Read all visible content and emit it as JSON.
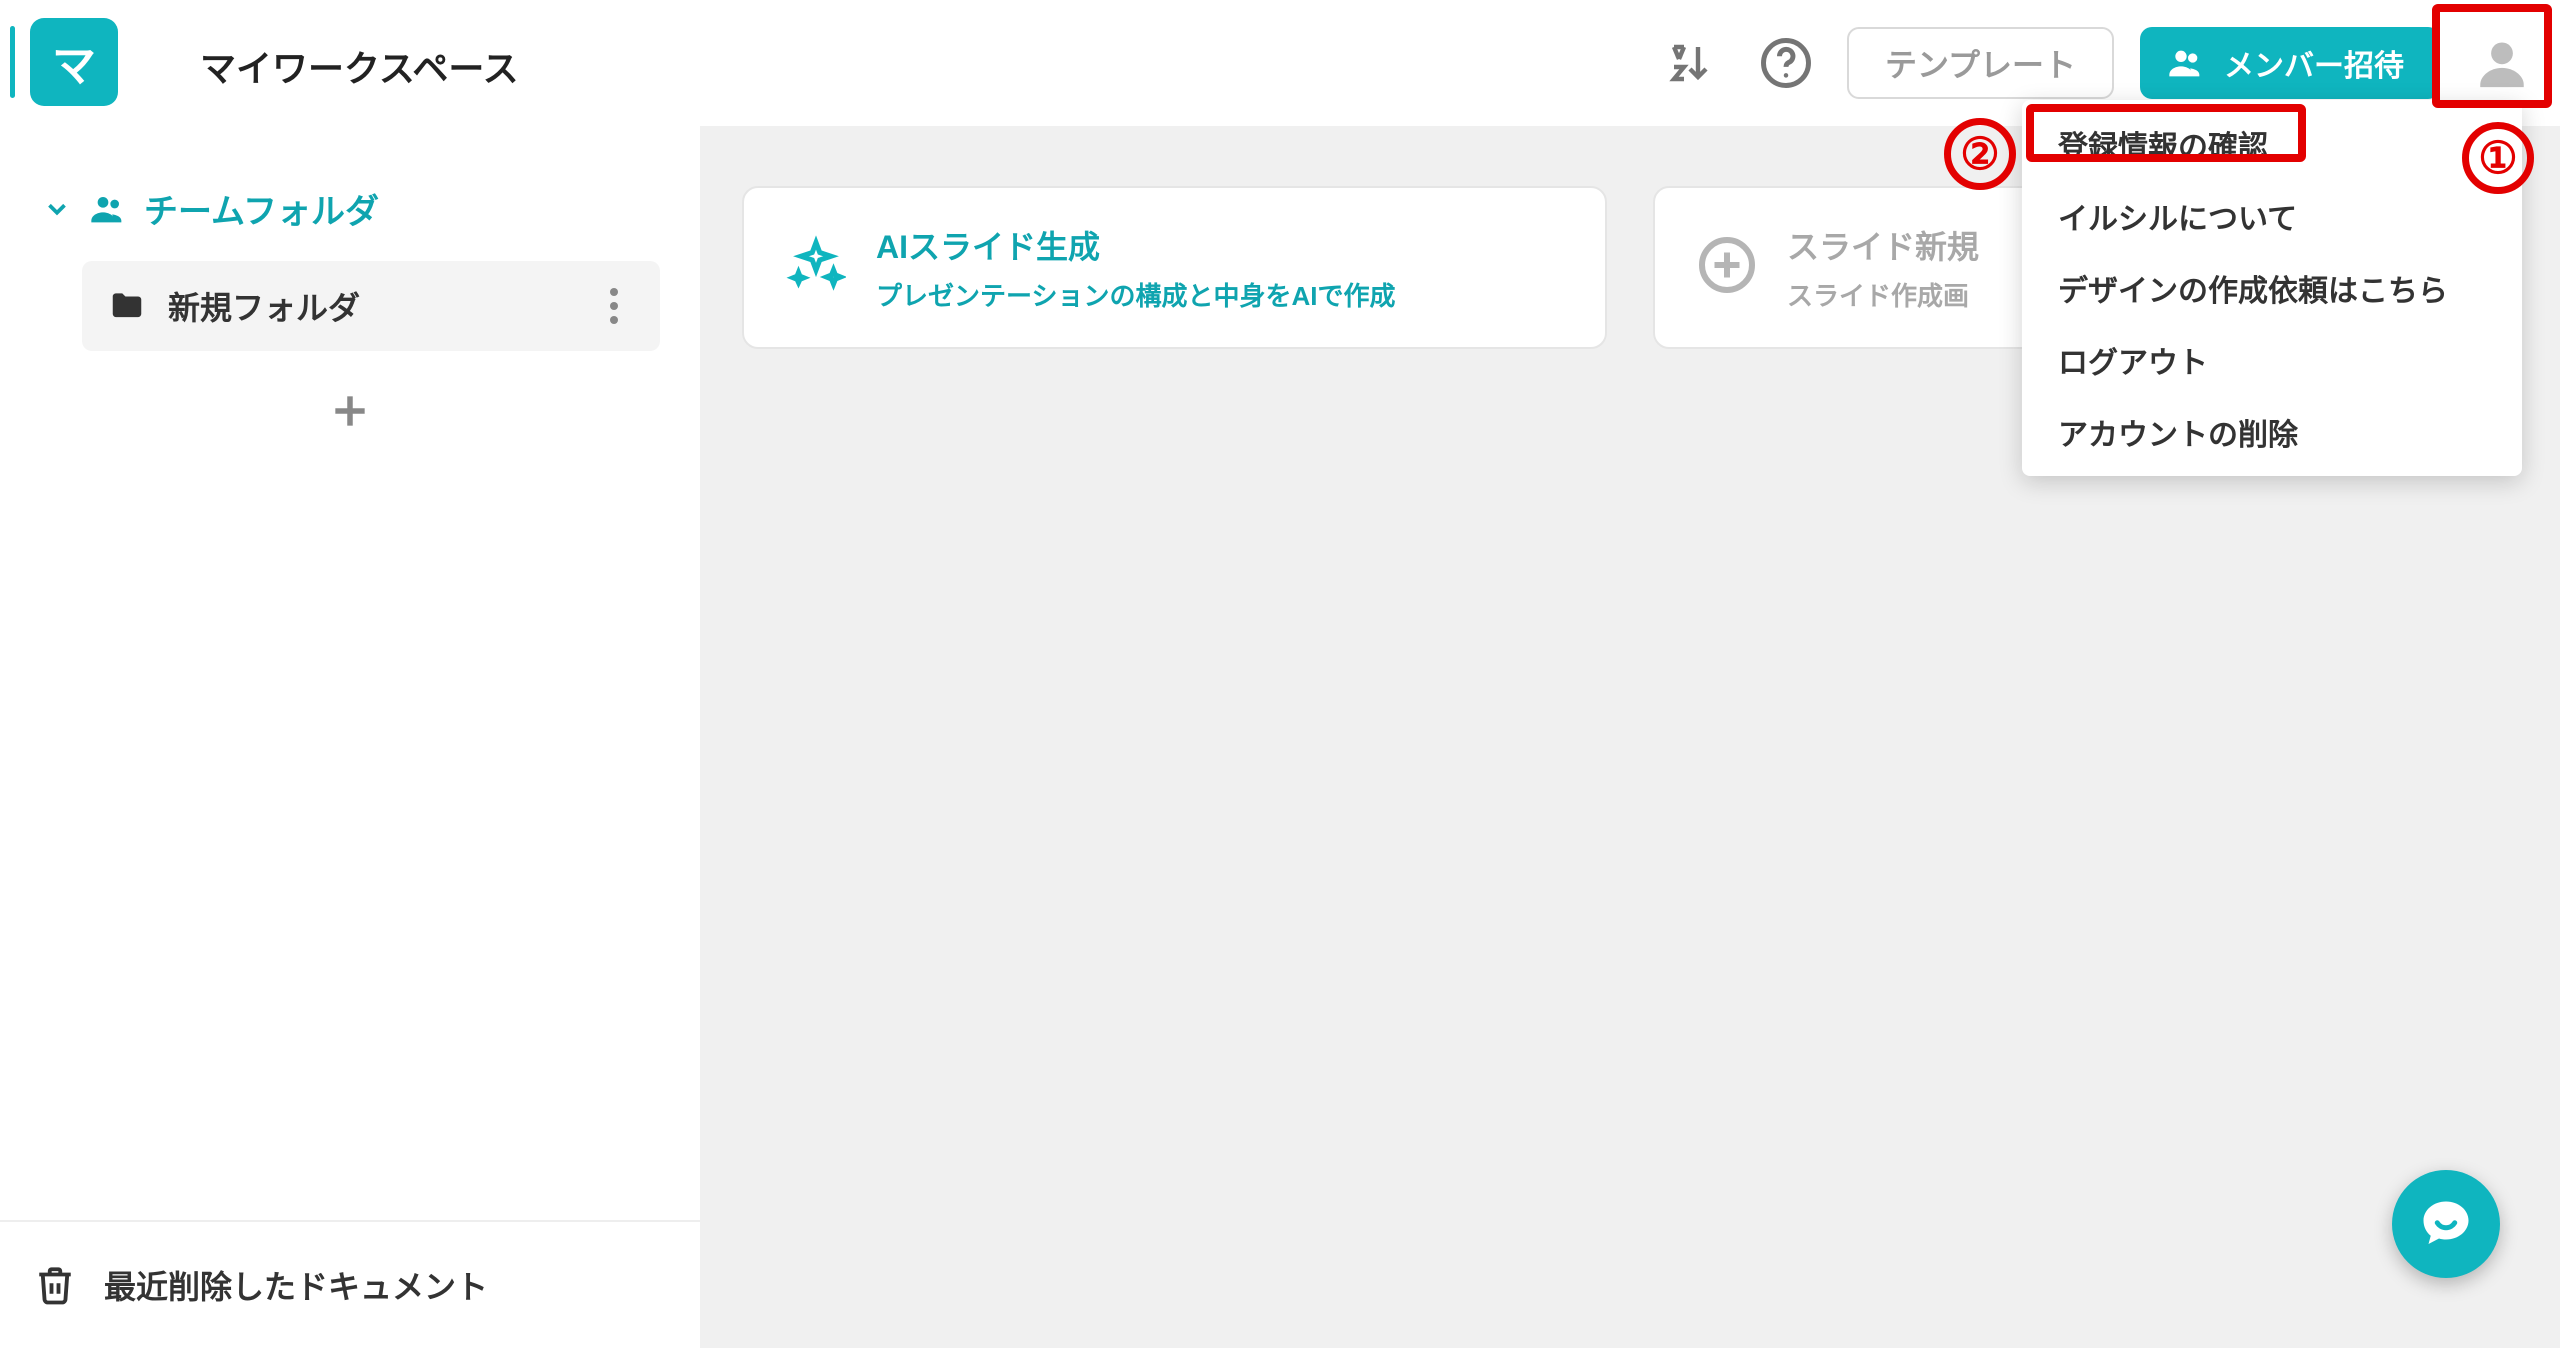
{
  "workspace": {
    "badge_letter": "マ",
    "title": "マイワークスペース"
  },
  "sidebar": {
    "team_folder_label": "チームフォルダ",
    "folders": [
      {
        "name": "新規フォルダ"
      }
    ],
    "trash_label": "最近削除したドキュメント"
  },
  "topbar": {
    "template_label": "テンプレート",
    "invite_label": "メンバー招待"
  },
  "cards": {
    "ai": {
      "title": "AIスライド生成",
      "subtitle": "プレゼンテーションの構成と中身をAIで作成"
    },
    "new": {
      "title": "スライド新規",
      "subtitle": "スライド作成画"
    }
  },
  "account_menu": {
    "items": [
      "登録情報の確認",
      "イルシルについて",
      "デザインの作成依頼はこちら",
      "ログアウト",
      "アカウントの削除"
    ]
  },
  "annotations": {
    "n1": "①",
    "n2": "②"
  }
}
